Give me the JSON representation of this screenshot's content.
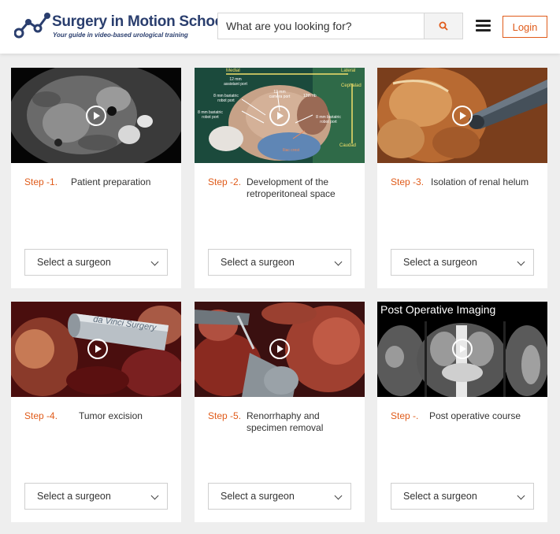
{
  "header": {
    "logo_title": "Surgery in Motion School",
    "logo_tagline": "Your guide in video-based urological training",
    "search_placeholder": "What are you looking for?",
    "login_label": "Login"
  },
  "colors": {
    "accent": "#e05b1a",
    "brand": "#2a3e6e",
    "background": "#eeeeee"
  },
  "cards": [
    {
      "step": "Step -1.",
      "title": "Patient preparation",
      "select": "Select a surgeon",
      "thumb": "ct-scan-axial"
    },
    {
      "step": "Step -2.",
      "title": "Development of the retroperitoneal space",
      "select": "Select a surgeon",
      "thumb": "port-placement-diagram",
      "thumb_labels": {
        "medial": "Medial",
        "lateral": "Lateral",
        "cephalad": "Cephalad",
        "caudad": "Caudad",
        "asst": "12 mm assistant port",
        "camera": "12 mm camera port",
        "robot8a": "8 mm bariatric robot port",
        "robot8b": "8 mm bariatric robot port",
        "robot8c": "8 mm bariatric robot port",
        "tip": "12th rib",
        "iliac": "Iliac crest"
      }
    },
    {
      "step": "Step -3.",
      "title": "Isolation of renal helum",
      "select": "Select a surgeon",
      "thumb": "surgical-video"
    },
    {
      "step": "Step -4.",
      "title": "Tumor excision",
      "select": "Select a surgeon",
      "thumb": "davinci-instrument",
      "thumb_text": "da Vinci Surgery"
    },
    {
      "step": "Step -5.",
      "title": "Renorrhaphy and specimen removal",
      "select": "Select a surgeon",
      "thumb": "surgical-video"
    },
    {
      "step": "Step -.",
      "title": "Post operative course",
      "select": "Select a surgeon",
      "thumb": "ct-scan-coronal",
      "thumb_caption": "Post Operative Imaging"
    }
  ]
}
